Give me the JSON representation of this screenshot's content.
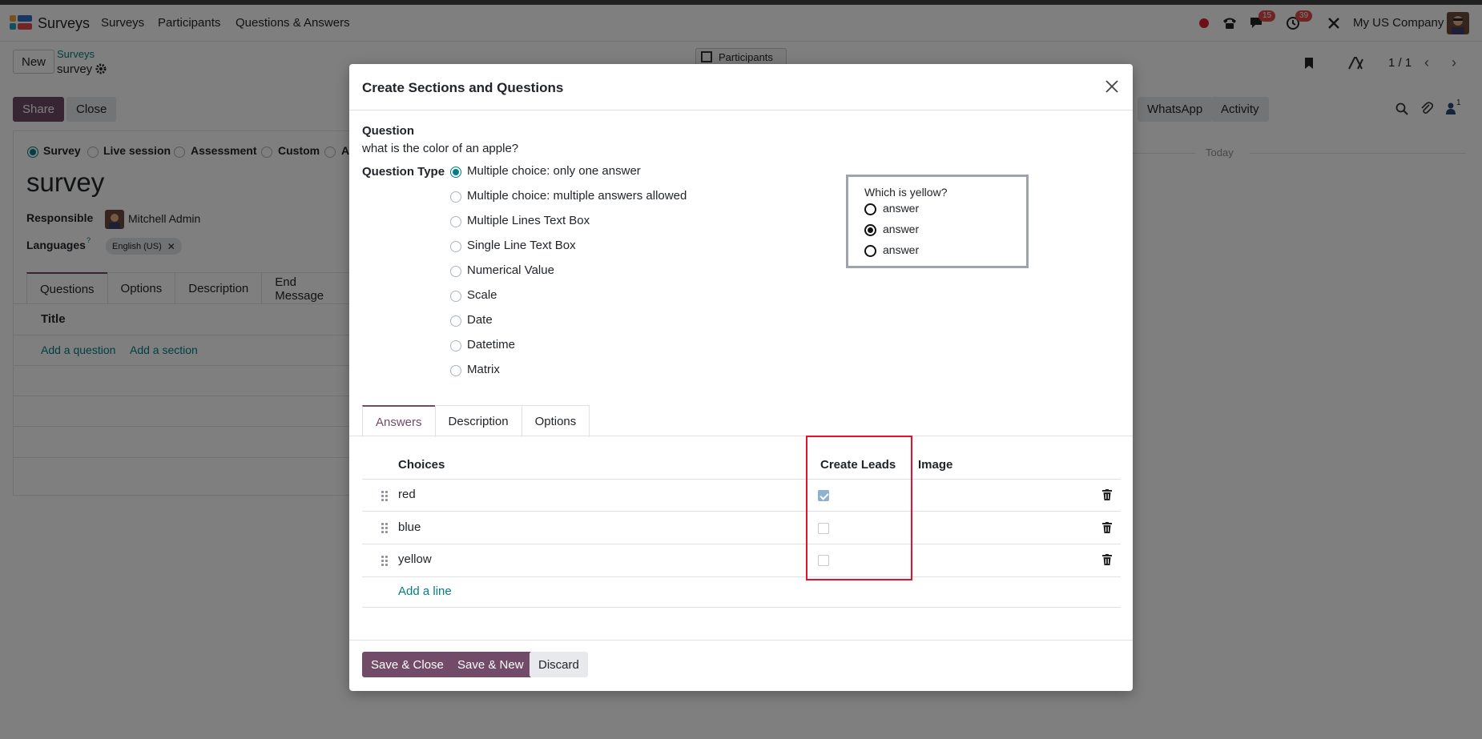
{
  "navbar": {
    "app_name": "Surveys",
    "menu": [
      "Surveys",
      "Participants",
      "Questions & Answers"
    ],
    "chat_badge": "15",
    "activity_badge": "39",
    "company": "My US Company"
  },
  "control_panel": {
    "new_label": "New",
    "breadcrumb_parent": "Surveys",
    "breadcrumb_current": "survey",
    "participants_label": "Participants",
    "pager": "1 / 1",
    "share_label": "Share",
    "close_label": "Close",
    "whatsapp_label": "WhatsApp",
    "activity_label": "Activity",
    "today_label": "Today",
    "follower_count": "1"
  },
  "form": {
    "survey_types": [
      "Survey",
      "Live session",
      "Assessment",
      "Custom",
      "A"
    ],
    "title": "survey",
    "responsible_label": "Responsible",
    "responsible_value": "Mitchell Admin",
    "languages_label": "Languages",
    "languages_help": "?",
    "language_tag": "English (US)",
    "tabs": [
      "Questions",
      "Options",
      "Description",
      "End Message"
    ],
    "list_header": "Title",
    "add_question": "Add a question",
    "add_section": "Add a section"
  },
  "modal": {
    "title": "Create Sections and Questions",
    "question_label": "Question",
    "question_value": "what is the color of an apple?",
    "question_type_label": "Question Type",
    "question_types": [
      "Multiple choice: only one answer",
      "Multiple choice: multiple answers allowed",
      "Multiple Lines Text Box",
      "Single Line Text Box",
      "Numerical Value",
      "Scale",
      "Date",
      "Datetime",
      "Matrix"
    ],
    "selected_type_index": 0,
    "preview": {
      "title": "Which is yellow?",
      "options": [
        "answer",
        "answer",
        "answer"
      ],
      "selected_index": 1
    },
    "tabs": [
      "Answers",
      "Description",
      "Options"
    ],
    "columns": {
      "choices": "Choices",
      "create_leads": "Create Leads",
      "image": "Image"
    },
    "rows": [
      {
        "choice": "red",
        "create_leads": true
      },
      {
        "choice": "blue",
        "create_leads": false
      },
      {
        "choice": "yellow",
        "create_leads": false
      }
    ],
    "add_line": "Add a line",
    "buttons": {
      "save_close": "Save & Close",
      "save_new": "Save & New",
      "discard": "Discard"
    },
    "highlight_color": "#e8112d"
  }
}
